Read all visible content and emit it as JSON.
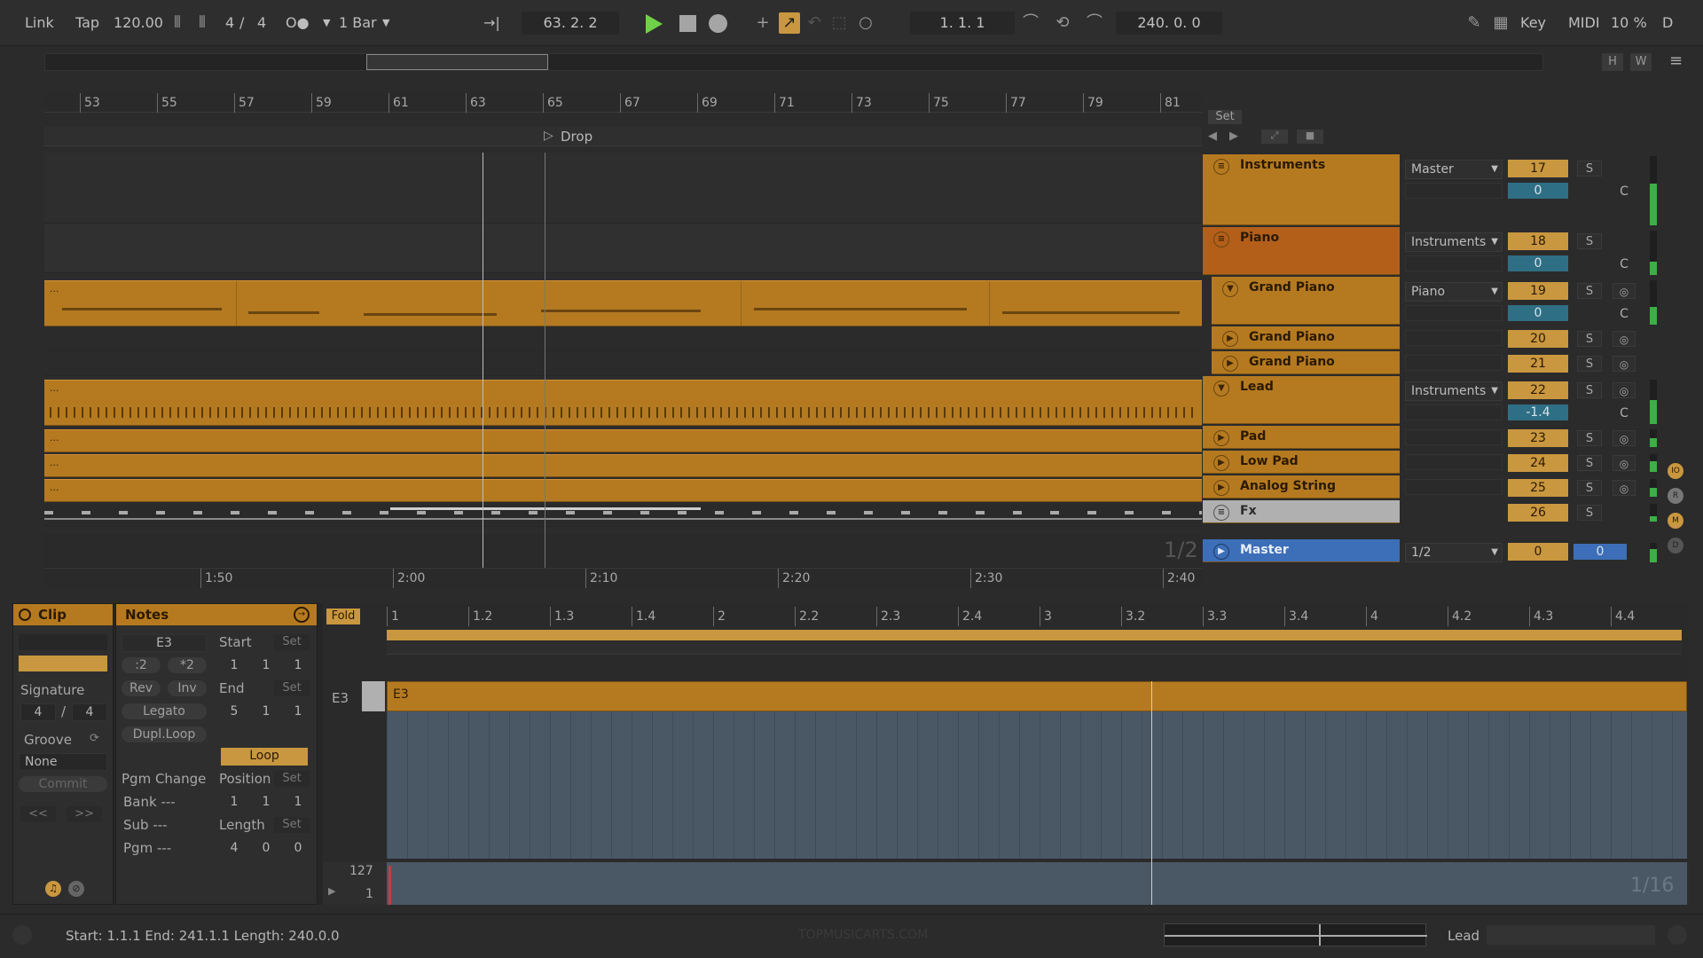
{
  "transport": {
    "link": "Link",
    "tap": "Tap",
    "tempo": "120.00",
    "sig_num": "4",
    "sig_sep": "/",
    "sig_den": "4",
    "metro_icon": "O●",
    "quant": "1 Bar",
    "follow_icon": "→|",
    "position": "63. 2. 2",
    "loop_start": "1. 1. 1",
    "loop_len": "240. 0. 0",
    "key": "Key",
    "midi": "MIDI",
    "cpu": "10 %",
    "disk": "D",
    "h_btn": "H",
    "w_btn": "W"
  },
  "arrangement": {
    "bar_ruler": [
      "53",
      "55",
      "57",
      "59",
      "61",
      "63",
      "65",
      "67",
      "69",
      "71",
      "73",
      "75",
      "77",
      "79",
      "81"
    ],
    "locator": "Drop",
    "time_ruler": [
      "1:50",
      "2:00",
      "2:10",
      "2:20",
      "2:30",
      "2:40"
    ],
    "clip_label": "...",
    "zoom": "1/2"
  },
  "set_panel": {
    "set": "Set"
  },
  "tracks": [
    {
      "name": "Instruments",
      "io": "Master",
      "num": "17",
      "pan": "0",
      "solo": "S",
      "center": "C"
    },
    {
      "name": "Piano",
      "io": "Instruments",
      "num": "18",
      "pan": "0",
      "solo": "S",
      "center": "C"
    },
    {
      "name": "Grand Piano",
      "io": "Piano",
      "num": "19",
      "pan": "0",
      "solo": "S",
      "center": "C"
    },
    {
      "name": "Grand Piano",
      "num": "20",
      "solo": "S"
    },
    {
      "name": "Grand Piano",
      "num": "21",
      "solo": "S"
    },
    {
      "name": "Lead",
      "io": "Instruments",
      "num": "22",
      "pan": "-1.4",
      "solo": "S",
      "center": "C"
    },
    {
      "name": "Pad",
      "num": "23",
      "solo": "S"
    },
    {
      "name": "Low Pad",
      "num": "24",
      "solo": "S"
    },
    {
      "name": "Analog String",
      "num": "25",
      "solo": "S"
    },
    {
      "name": "Fx",
      "num": "26",
      "solo": "S"
    },
    {
      "name": "Master",
      "io": "1/2",
      "num": "0",
      "pan": "0"
    }
  ],
  "clip_panel": {
    "title": "Clip",
    "signature_label": "Signature",
    "sig_num": "4",
    "sig_sep": "/",
    "sig_den": "4",
    "groove_label": "Groove",
    "groove_value": "None",
    "commit": "Commit",
    "prev": "<<",
    "next": ">>"
  },
  "notes_panel": {
    "title": "Notes",
    "note": "E3",
    "half": ":2",
    "double": "*2",
    "rev": "Rev",
    "inv": "Inv",
    "legato": "Legato",
    "dupl_loop": "Dupl.Loop",
    "start_label": "Start",
    "set": "Set",
    "start": [
      "1",
      "1",
      "1"
    ],
    "end_label": "End",
    "end": [
      "5",
      "1",
      "1"
    ],
    "loop": "Loop",
    "pgm_change": "Pgm Change",
    "bank": "Bank ---",
    "sub": "Sub ---",
    "pgm": "Pgm ---",
    "position_label": "Position",
    "position": [
      "1",
      "1",
      "1"
    ],
    "length_label": "Length",
    "length": [
      "4",
      "0",
      "0"
    ]
  },
  "editor": {
    "fold": "Fold",
    "ruler": [
      "1",
      "1.2",
      "1.3",
      "1.4",
      "2",
      "2.2",
      "2.3",
      "2.4",
      "3",
      "3.2",
      "3.3",
      "3.4",
      "4",
      "4.2",
      "4.3",
      "4.4"
    ],
    "key_label": "E3",
    "note_label": "E3",
    "vel_max": "127",
    "vel_min": "1",
    "grid": "1/16"
  },
  "status": {
    "text": "Start: 1.1.1  End: 241.1.1  Length: 240.0.0",
    "watermark": "TOPMUSICARTS.COM",
    "track": "Lead"
  }
}
